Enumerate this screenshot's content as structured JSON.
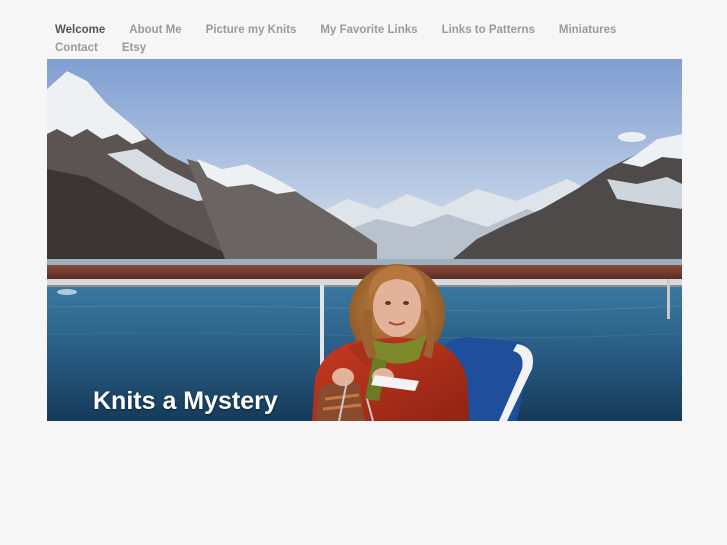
{
  "nav": {
    "items": [
      {
        "label": "Welcome",
        "active": true
      },
      {
        "label": "About Me",
        "active": false
      },
      {
        "label": "Picture my Knits",
        "active": false
      },
      {
        "label": "My Favorite Links",
        "active": false
      },
      {
        "label": "Links to Patterns",
        "active": false
      },
      {
        "label": "Miniatures",
        "active": false
      },
      {
        "label": "Contact",
        "active": false
      },
      {
        "label": "Etsy",
        "active": false
      }
    ]
  },
  "header": {
    "site_title": "Knits a Mystery"
  },
  "colors": {
    "background": "#f6f6f6",
    "nav_text": "#9a9a9a",
    "nav_active": "#555555",
    "title_text": "#ffffff"
  }
}
